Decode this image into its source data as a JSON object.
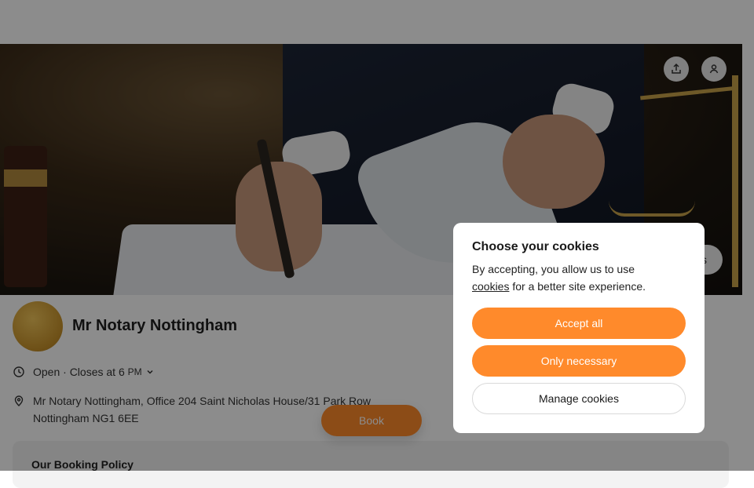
{
  "business": {
    "name": "Mr Notary Nottingham",
    "hours_status": "Open · Closes at 6",
    "hours_suffix": "PM",
    "address_line1": "Mr Notary Nottingham, Office 204 Saint Nicholas House/31 Park Row",
    "address_line2": "Nottingham NG1 6EE"
  },
  "actions": {
    "book_label": "Book",
    "pill_label": "s"
  },
  "policy": {
    "title": "Our Booking Policy"
  },
  "icons": {
    "share": "share-icon",
    "account": "user-icon",
    "clock": "clock-icon",
    "location": "location-pin-icon",
    "chevron": "chevron-down-icon"
  },
  "cookie_dialog": {
    "title": "Choose your cookies",
    "body_before": "By accepting, you allow us to use",
    "link_text": "cookies",
    "body_after": "for a better site experience.",
    "accept_all": "Accept all",
    "only_necessary": "Only necessary",
    "manage": "Manage cookies"
  },
  "colors": {
    "accent": "#ff8a2b",
    "overlay": "rgba(0,0,0,0.45)"
  }
}
